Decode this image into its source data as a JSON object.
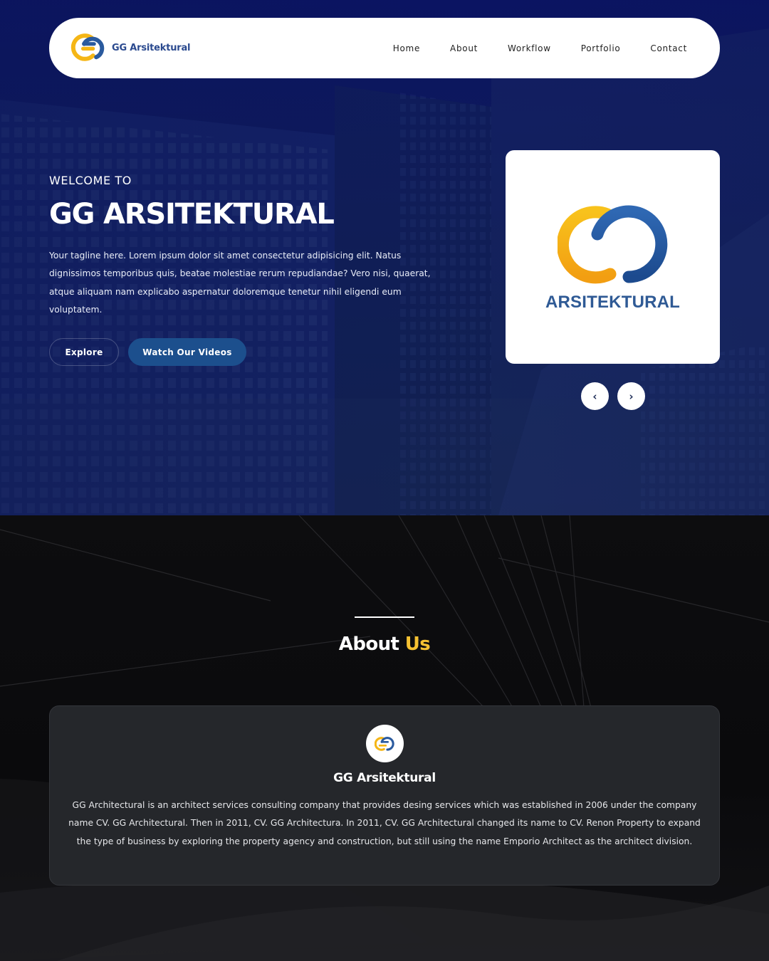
{
  "colors": {
    "hero_bg": "#0b1463",
    "brand_blue": "#2f5a95",
    "brand_yellow": "#f5c132",
    "button_blue": "#1c4f8d",
    "about_bg": "#0a0a0c",
    "card_bg": "#25272b"
  },
  "navbar": {
    "brand_name": "GG Arsitektural",
    "logo_icon": "gg-logo-icon",
    "links": [
      {
        "label": "Home"
      },
      {
        "label": "About"
      },
      {
        "label": "Workflow"
      },
      {
        "label": "Portfolio"
      },
      {
        "label": "Contact"
      }
    ]
  },
  "hero": {
    "welcome": "WELCOME TO",
    "title": "GG ARSITEKTURAL",
    "tagline": "Your tagline here. Lorem ipsum dolor sit amet consectetur adipisicing elit. Natus dignissimos temporibus quis, beatae molestiae rerum repudiandae? Vero nisi, quaerat, atque aliquam nam explicabo aspernatur doloremque tenetur nihil eligendi eum voluptatem.",
    "explore_label": "Explore",
    "videos_label": "Watch Our Videos"
  },
  "carousel": {
    "slide_caption": "ARSITEKTURAL",
    "prev_icon": "‹",
    "next_icon": "›"
  },
  "about": {
    "heading_main": "About",
    "heading_accent": "Us",
    "company_name": "GG Arsitektural",
    "description": "GG Architectural is an architect services consulting company that provides desing services which was established in 2006 under the company name CV. GG Architectural. Then in 2011, CV. GG Architectura. In 2011, CV. GG Architectural changed its name to CV. Renon Property to expand the type of business by exploring the property agency and construction, but still using the name Emporio Architect as the architect division."
  }
}
